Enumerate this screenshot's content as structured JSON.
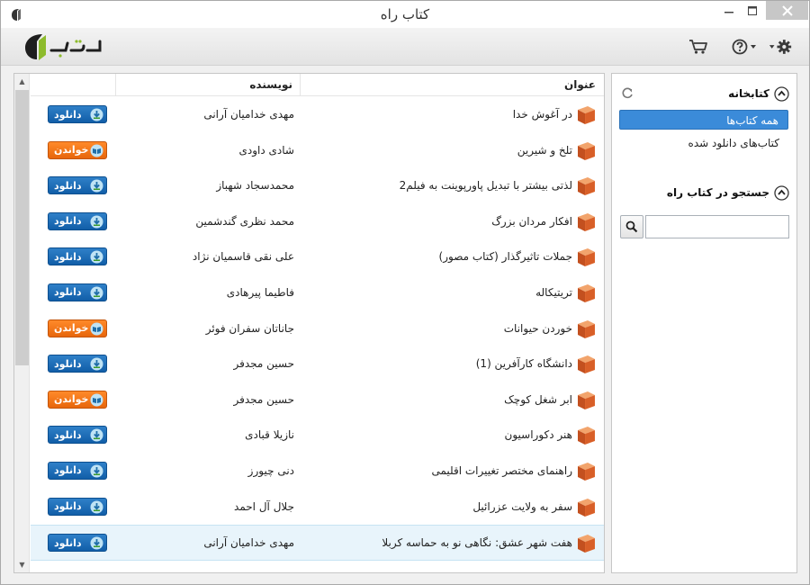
{
  "window": {
    "title": "کتاب راه",
    "logo_text": "کتاب راه"
  },
  "colors": {
    "accent": "#3b8bd9",
    "download_blue": "#1766b0",
    "read_orange": "#f07618",
    "book_icon": "#d9652c",
    "selected_row": "#e8f4fb"
  },
  "toolbar": {
    "cart_icon": "cart-icon",
    "help_icon": "help-icon",
    "settings_icon": "gear-icon"
  },
  "list": {
    "columns": {
      "title": "عنوان",
      "author": "نویسنده",
      "action": ""
    },
    "rows": [
      {
        "title": "در آغوش خدا",
        "author": "مهدی خدامیان آرانی",
        "action": "دانلود",
        "type": "download"
      },
      {
        "title": "تلخ و شیرین",
        "author": "شادی داودی",
        "action": "خواندن",
        "type": "read"
      },
      {
        "title": "لذتی بیشتر با تبدیل پاورپوینت به فیلم2",
        "author": "محمدسجاد شهباز",
        "action": "دانلود",
        "type": "download"
      },
      {
        "title": "افکار مردان بزرگ",
        "author": "محمد نظری گندشمین",
        "action": "دانلود",
        "type": "download"
      },
      {
        "title": "جملات تاثیرگذار (کتاب مصور)",
        "author": "علی نقی قاسمیان نژاد",
        "action": "دانلود",
        "type": "download"
      },
      {
        "title": "تریتیکاله",
        "author": "فاطیما پیرهادی",
        "action": "دانلود",
        "type": "download"
      },
      {
        "title": "خوردن حیوانات",
        "author": "جاناتان سفران فوئر",
        "action": "خواندن",
        "type": "read"
      },
      {
        "title": "دانشگاه کارآفرین (1)",
        "author": "حسین مجدفر",
        "action": "دانلود",
        "type": "download"
      },
      {
        "title": "ابر شغل کوچک",
        "author": "حسین مجدفر",
        "action": "خواندن",
        "type": "read"
      },
      {
        "title": "هنر دکوراسیون",
        "author": "نازیلا قبادی",
        "action": "دانلود",
        "type": "download"
      },
      {
        "title": "راهنمای مختصر تغییرات اقلیمی",
        "author": "دنی چیورز",
        "action": "دانلود",
        "type": "download"
      },
      {
        "title": "سفر به ولایت عزرائیل",
        "author": "جلال آل احمد",
        "action": "دانلود",
        "type": "download"
      },
      {
        "title": "هفت شهر عشق: نگاهی نو به حماسه کربلا",
        "author": "مهدی خدامیان آرانی",
        "action": "دانلود",
        "type": "download",
        "selected": true
      }
    ]
  },
  "sidebar": {
    "library_heading": "کتابخانه",
    "items": [
      {
        "label": "همه کتاب‌ها",
        "active": true
      },
      {
        "label": "کتاب‌های دانلود شده",
        "active": false
      }
    ],
    "search_heading": "جستجو در کتاب راه",
    "search_value": ""
  }
}
